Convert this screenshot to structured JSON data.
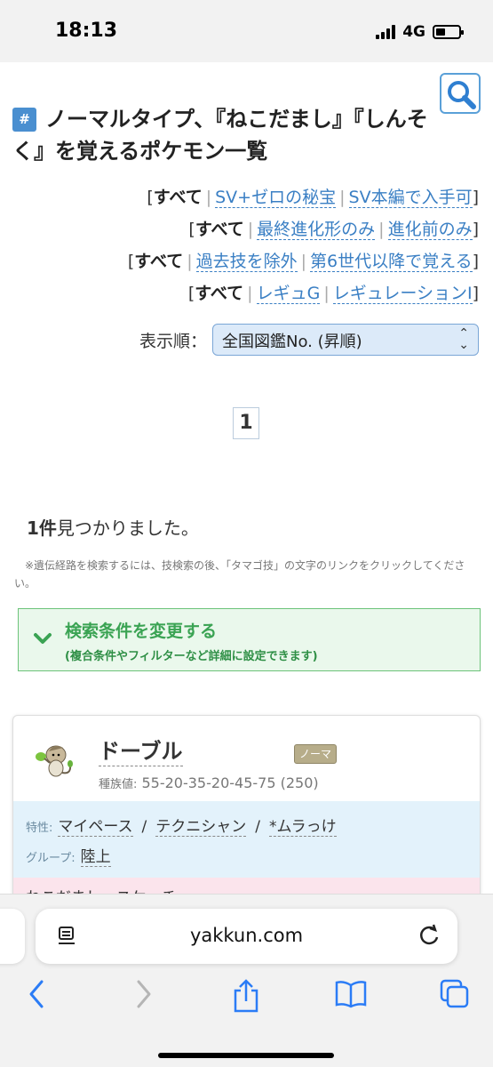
{
  "status": {
    "time": "18:13",
    "network": "4G"
  },
  "page": {
    "title_hash": "#",
    "title": "ノーマルタイプ、『ねこだまし』『しんそく』を覚えるポケモン一覧"
  },
  "filters": [
    {
      "all": "すべて",
      "opts": [
        "SV+ゼロの秘宝",
        "SV本編で入手可"
      ]
    },
    {
      "all": "すべて",
      "opts": [
        "最終進化形のみ",
        "進化前のみ"
      ]
    },
    {
      "all": "すべて",
      "opts": [
        "過去技を除外",
        "第6世代以降で覚える"
      ]
    },
    {
      "all": "すべて",
      "opts": [
        "レギュG",
        "レギュレーションI"
      ]
    }
  ],
  "sort": {
    "label": "表示順：",
    "value": "全国図鑑No. (昇順)"
  },
  "pagination": {
    "current": "1"
  },
  "results": {
    "count": "1件",
    "count_suffix": "見つかりました。",
    "note": "※遺伝経路を検索するには、技検索の後、「タマゴ技」の文字のリンクをクリックしてください。"
  },
  "condition": {
    "title": "検索条件を変更する",
    "subtitle": "(複合条件やフィルターなど詳細に設定できます)"
  },
  "pokemon": {
    "name": "ドーブル",
    "type": "ノーマル",
    "stats_label": "種族値:",
    "stats": "55-20-35-20-45-75 (250)",
    "ability_label": "特性:",
    "abilities": [
      "マイペース",
      "テクニシャン",
      "*ムラっけ"
    ],
    "group_label": "グループ:",
    "group": "陸上",
    "moves": "ねこだまし・スケッチ"
  },
  "browser": {
    "url": "yakkun.com"
  },
  "colors": {
    "accent": "#3a7fc4",
    "condition_green": "#3aa353",
    "type_normal": "#b7ad8a"
  }
}
